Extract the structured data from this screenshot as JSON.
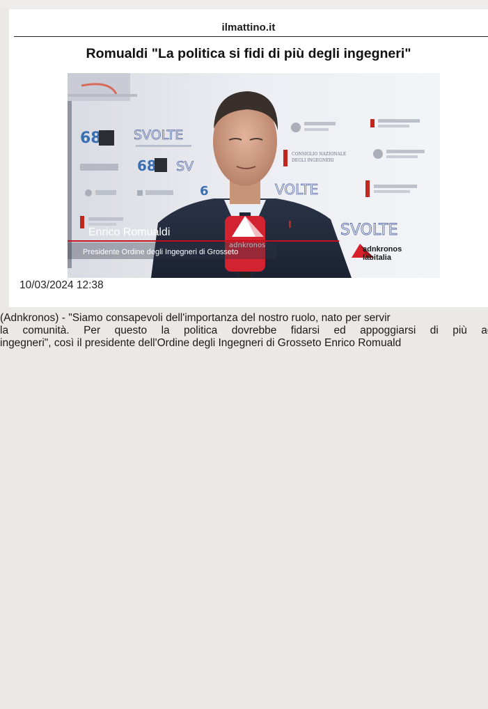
{
  "site": {
    "name": "ilmattino.it"
  },
  "article": {
    "headline": "Romualdi \"La politica si fidi di più degli ingegneri\"",
    "date": "10/03/2024 12:38",
    "body_lines": [
      "(Adnkronos) - \"Siamo consapevoli dell'importanza del nostro ruolo, nato per servir",
      "la comunità. Per questo la politica dovrebbe fidarsi ed appoggiarsi di più agl",
      "ingegneri\", così il presidente dell'Ordine degli Ingegneri di Grosseto Enrico Romuald"
    ]
  },
  "video": {
    "speaker_name": "Enrico Romualdi",
    "speaker_title": "Presidente Ordine degli Ingegneri di Grosseto",
    "mic_brand": "adnkronos",
    "watermark_line1": "adnkronos",
    "watermark_line2": "labitalia",
    "backdrop": {
      "svolte": "SVOLTE",
      "badge_number": "68",
      "consiglio": "CONSIGLIO NAZIONALE",
      "ingegneri": "DEGLI INGEGNERI"
    },
    "colors": {
      "accent_red": "#d8202a",
      "lower_third_red": "#c4101a"
    }
  }
}
